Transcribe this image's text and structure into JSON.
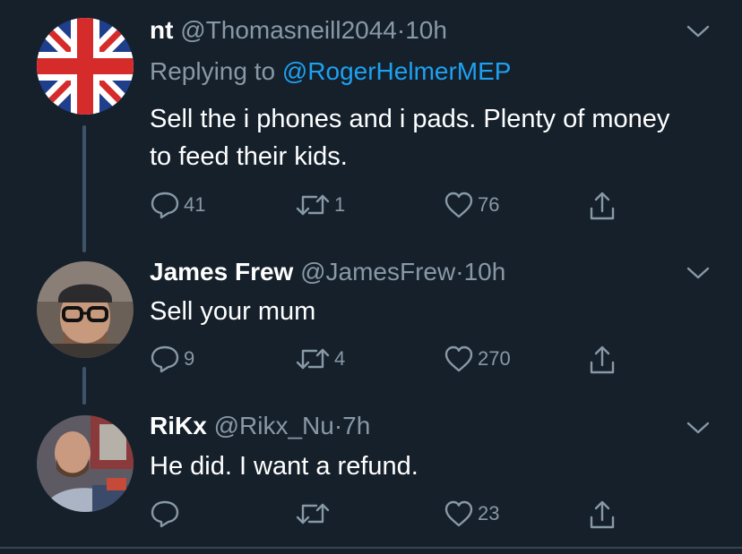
{
  "colors": {
    "background": "#15202b",
    "text": "#ffffff",
    "muted": "#8899a6",
    "link": "#1da1f2",
    "thread": "#3d5466"
  },
  "tweets": [
    {
      "name": "nt",
      "handle": "@Thomasneill2044",
      "dot": "·",
      "time": "10h",
      "reply_prefix": "Replying to ",
      "reply_mention": "@RogerHelmerMEP",
      "text": "Sell the i phones and i pads. Plenty of money to feed their kids.",
      "replies": "41",
      "retweets": "1",
      "likes": "76",
      "avatar": "union-jack-flag"
    },
    {
      "name": "James Frew",
      "handle": "@JamesFrew",
      "dot": "·",
      "time": "10h",
      "text": "Sell your mum",
      "replies": "9",
      "retweets": "4",
      "likes": "270",
      "avatar": "man-with-glasses-and-cap"
    },
    {
      "name": "RiKx",
      "handle": "@Rikx_Nu",
      "dot": "·",
      "time": "7h",
      "text": "He did. I want a refund.",
      "replies": "",
      "retweets": "",
      "likes": "23",
      "avatar": "bearded-man-photo"
    }
  ],
  "icons": {
    "reply": "reply-icon",
    "retweet": "retweet-icon",
    "like": "heart-icon",
    "share": "share-icon",
    "menu": "chevron-down-icon"
  }
}
